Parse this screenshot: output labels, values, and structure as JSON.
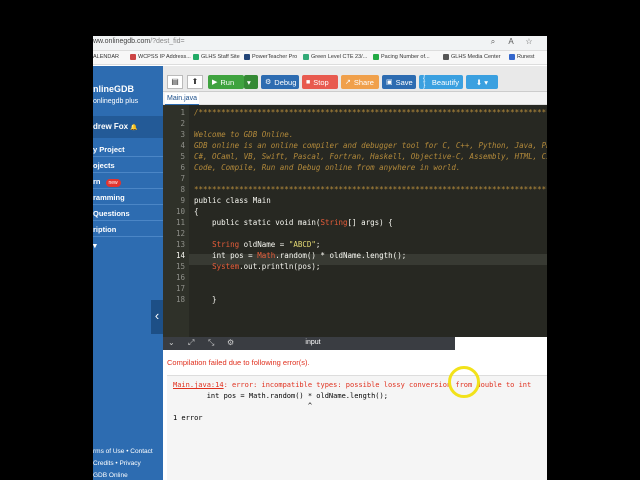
{
  "browser": {
    "url_host": "ww.onlinegdb.com",
    "url_path": "/?dest_fid=",
    "zoom_icon": "zoom-icon",
    "reader_icon": "read-aloud-icon",
    "favorite_icon": "star-icon",
    "bookmarks": [
      "ALENDAR",
      "WCPSS IP Address...",
      "GLHS Staff Site",
      "PowerTeacher Pro",
      "Green Level CTE 23/...",
      "Pacing Number of...",
      "GLHS Media Center",
      "Runest"
    ]
  },
  "sidebar": {
    "brand": "nlineGDB",
    "brand_sub": "onlinegdb plus",
    "user": "drew Fox",
    "bell_icon": "🔔",
    "items": [
      {
        "label": "y Project"
      },
      {
        "label": "ojects"
      },
      {
        "label": "rn",
        "badge": "new"
      },
      {
        "label": "ramming"
      },
      {
        "label": "Questions"
      },
      {
        "label": "ription"
      },
      {
        "label": "▾"
      }
    ],
    "footer": [
      "rms of Use • Contact",
      "Credits • Privacy",
      "GDB Online"
    ],
    "collapse_glyph": "‹"
  },
  "toolbar": {
    "new_icon": "📄",
    "upload_icon": "⬆",
    "run": "Run",
    "run_icon": "▶",
    "debug": "Debug",
    "debug_icon": "⚙",
    "stop": "Stop",
    "stop_icon": "■",
    "share": "Share",
    "share_icon": "↗",
    "save": "Save",
    "save_icon": "💾",
    "beautify": "Beautify",
    "beautify_icon": "{ }",
    "download_icon": "⬇"
  },
  "file_tab": "Main.java",
  "editor": {
    "lines": [
      {
        "n": "1",
        "text": "/******************************************************************************"
      },
      {
        "n": "2",
        "text": ""
      },
      {
        "n": "3",
        "text": "Welcome to GDB Online."
      },
      {
        "n": "4",
        "text": "GDB online is an online compiler and debugger tool for C, C++, Python, Java, PHP, Ruby, Perl,"
      },
      {
        "n": "5",
        "text": "C#, OCaml, VB, Swift, Pascal, Fortran, Haskell, Objective-C, Assembly, HTML, CSS, JS, SQLite, Prolog."
      },
      {
        "n": "6",
        "text": "Code, Compile, Run and Debug online from anywhere in world."
      },
      {
        "n": "7",
        "text": ""
      },
      {
        "n": "8",
        "text": "*******************************************************************************/"
      },
      {
        "n": "9",
        "text": "public class Main"
      },
      {
        "n": "10",
        "text": "{"
      },
      {
        "n": "11",
        "pre": "    public static void main(",
        "ty": "String",
        "post": "[] args) {"
      },
      {
        "n": "12",
        "text": ""
      },
      {
        "n": "13",
        "pre": "    ",
        "ty": "String",
        "mid": " oldName = ",
        "str": "\"ABCD\"",
        "post": ";"
      },
      {
        "n": "14",
        "pre": "    int pos = ",
        "ty": "Math",
        "post": ".random() * oldName.length();"
      },
      {
        "n": "15",
        "pre": "    ",
        "ty": "System",
        "post": ".out.println(pos);"
      },
      {
        "n": "16",
        "text": ""
      },
      {
        "n": "17",
        "text": ""
      },
      {
        "n": "18",
        "text": "    }"
      }
    ]
  },
  "io": {
    "tab_label": "input",
    "collapse_icon": "chevron-down-icon",
    "expand_icon": "expand-icon",
    "compact_icon": "compress-icon",
    "settings_icon": "gear-icon"
  },
  "output": {
    "fail_message": "Compilation failed due to following error(s).",
    "err_file": "Main.java:14",
    "err_text": ": error: incompatible types: possible lossy conversion from double to int",
    "err_code": "        int pos = Math.random() * oldName.length();",
    "err_caret": "                                ^",
    "err_count": "1 error"
  }
}
